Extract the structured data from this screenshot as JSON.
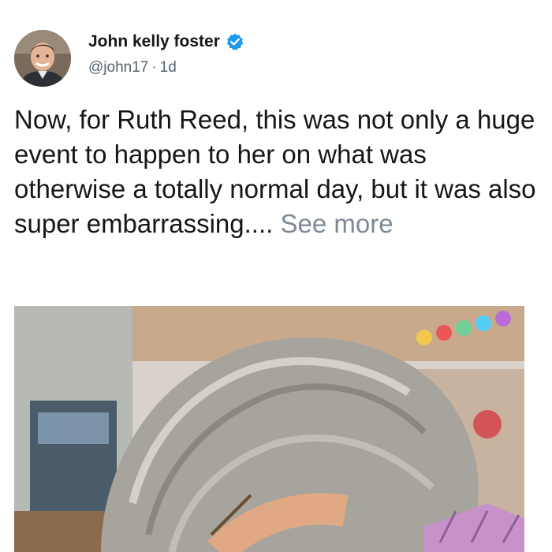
{
  "author": {
    "name": "John kelly foster",
    "handle": "@john17",
    "separator": "·",
    "time": "1d",
    "avatar_icon": "profile-photo"
  },
  "tweet": {
    "text": "Now, for Ruth Reed, this was not only a huge event to happen to her on what was otherwise a totally normal day, but it was also super embarrassing....",
    "see_more": "See more"
  },
  "colors": {
    "verified": "#1d9bf0",
    "see_more": "#7d8a96",
    "text": "#14171a"
  }
}
